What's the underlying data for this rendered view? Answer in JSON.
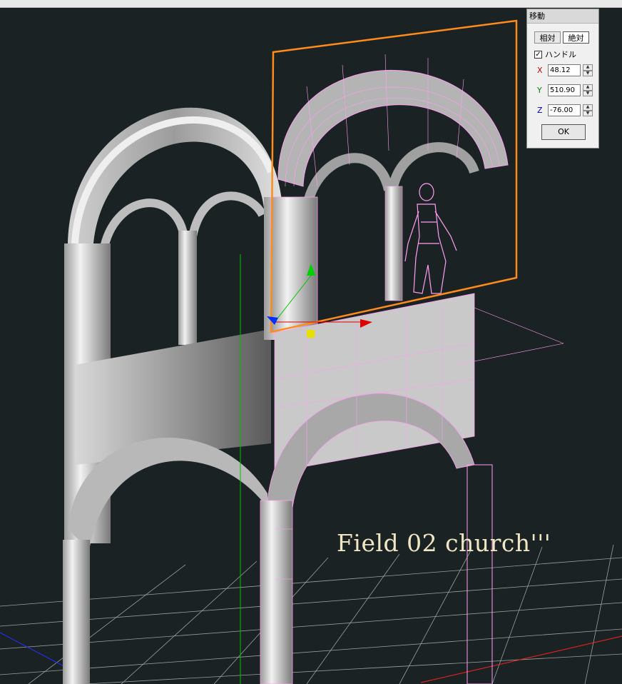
{
  "dialog": {
    "title": "移動",
    "tabs": [
      {
        "label": "相対",
        "active": false
      },
      {
        "label": "絶対",
        "active": true
      }
    ],
    "handle_label": "ハンドル",
    "handle_checked": true,
    "fields": [
      {
        "axis": "X",
        "value": "48.12",
        "color": "#c00000"
      },
      {
        "axis": "Y",
        "value": "510.90",
        "color": "#008000"
      },
      {
        "axis": "Z",
        "value": "-76.00",
        "color": "#0000c0"
      }
    ],
    "ok_label": "OK"
  },
  "viewport": {
    "caption": "Field 02 church'''",
    "colors": {
      "background": "#1b2224",
      "grid": "#c8c8c8",
      "wireframe": "#ff9ef2",
      "selection_box": "#ff8c1a",
      "axis_x": "#e00000",
      "axis_y": "#00c000",
      "axis_z": "#0030ff",
      "handle_center": "#e8e000"
    }
  }
}
